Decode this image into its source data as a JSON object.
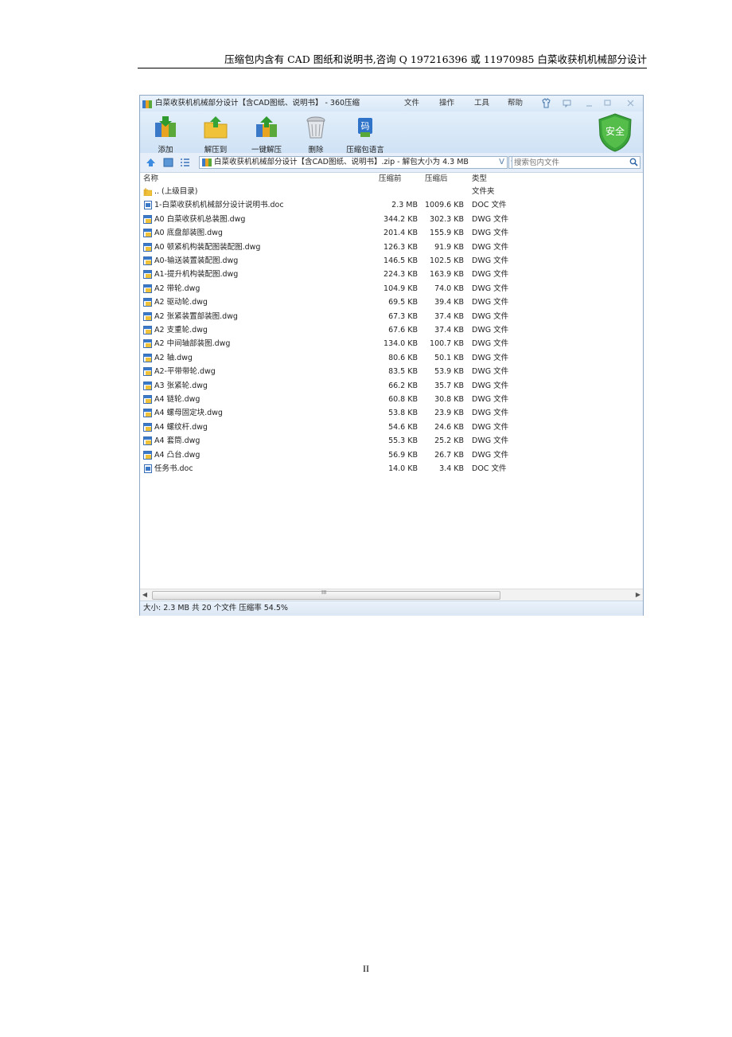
{
  "page": {
    "header": "压缩包内含有 CAD 图纸和说明书,咨询 Q 197216396 或 11970985 白菜收获机机械部分设计",
    "footer": "II"
  },
  "window": {
    "title": "白菜收获机机械部分设计【含CAD图纸、说明书】 - 360压缩",
    "menus": [
      "文件",
      "操作",
      "工具",
      "帮助"
    ],
    "toolbar": [
      "添加",
      "解压到",
      "一键解压",
      "删除",
      "压缩包语言"
    ],
    "safe_label": "安全",
    "path": "白菜收获机机械部分设计【含CAD图纸、说明书】.zip - 解包大小为 4.3 MB",
    "search_placeholder": "搜索包内文件",
    "columns": {
      "name": "名称",
      "before": "压缩前",
      "after": "压缩后",
      "type": "类型"
    },
    "rows": [
      {
        "name": ".. (上级目录)",
        "before": "",
        "after": "",
        "type": "文件夹",
        "icon": "folder-icon"
      },
      {
        "name": "1-白菜收获机机械部分设计说明书.doc",
        "before": "2.3 MB",
        "after": "1009.6 KB",
        "type": "DOC 文件",
        "icon": "doc-icon"
      },
      {
        "name": "A0 白菜收获机总装图.dwg",
        "before": "344.2 KB",
        "after": "302.3 KB",
        "type": "DWG 文件",
        "icon": "dwg-icon"
      },
      {
        "name": "A0 底盘部装图.dwg",
        "before": "201.4 KB",
        "after": "155.9 KB",
        "type": "DWG 文件",
        "icon": "dwg-icon"
      },
      {
        "name": "A0 顿紧机构装配图装配图.dwg",
        "before": "126.3 KB",
        "after": "91.9 KB",
        "type": "DWG 文件",
        "icon": "dwg-icon"
      },
      {
        "name": "A0-输送装置装配图.dwg",
        "before": "146.5 KB",
        "after": "102.5 KB",
        "type": "DWG 文件",
        "icon": "dwg-icon"
      },
      {
        "name": "A1-提升机构装配图.dwg",
        "before": "224.3 KB",
        "after": "163.9 KB",
        "type": "DWG 文件",
        "icon": "dwg-icon"
      },
      {
        "name": "A2 带轮.dwg",
        "before": "104.9 KB",
        "after": "74.0 KB",
        "type": "DWG 文件",
        "icon": "dwg-icon"
      },
      {
        "name": "A2 驱动轮.dwg",
        "before": "69.5 KB",
        "after": "39.4 KB",
        "type": "DWG 文件",
        "icon": "dwg-icon"
      },
      {
        "name": "A2 张紧装置部装图.dwg",
        "before": "67.3 KB",
        "after": "37.4 KB",
        "type": "DWG 文件",
        "icon": "dwg-icon"
      },
      {
        "name": "A2 支重轮.dwg",
        "before": "67.6 KB",
        "after": "37.4 KB",
        "type": "DWG 文件",
        "icon": "dwg-icon"
      },
      {
        "name": "A2 中间轴部装图.dwg",
        "before": "134.0 KB",
        "after": "100.7 KB",
        "type": "DWG 文件",
        "icon": "dwg-icon"
      },
      {
        "name": "A2 轴.dwg",
        "before": "80.6 KB",
        "after": "50.1 KB",
        "type": "DWG 文件",
        "icon": "dwg-icon"
      },
      {
        "name": "A2-平带带轮.dwg",
        "before": "83.5 KB",
        "after": "53.9 KB",
        "type": "DWG 文件",
        "icon": "dwg-icon"
      },
      {
        "name": "A3 张紧轮.dwg",
        "before": "66.2 KB",
        "after": "35.7 KB",
        "type": "DWG 文件",
        "icon": "dwg-icon"
      },
      {
        "name": "A4 链轮.dwg",
        "before": "60.8 KB",
        "after": "30.8 KB",
        "type": "DWG 文件",
        "icon": "dwg-icon"
      },
      {
        "name": "A4 螺母固定块.dwg",
        "before": "53.8 KB",
        "after": "23.9 KB",
        "type": "DWG 文件",
        "icon": "dwg-icon"
      },
      {
        "name": "A4 螺纹杆.dwg",
        "before": "54.6 KB",
        "after": "24.6 KB",
        "type": "DWG 文件",
        "icon": "dwg-icon"
      },
      {
        "name": "A4 套筒.dwg",
        "before": "55.3 KB",
        "after": "25.2 KB",
        "type": "DWG 文件",
        "icon": "dwg-icon"
      },
      {
        "name": "A4 凸台.dwg",
        "before": "56.9 KB",
        "after": "26.7 KB",
        "type": "DWG 文件",
        "icon": "dwg-icon"
      },
      {
        "name": "任务书.doc",
        "before": "14.0 KB",
        "after": "3.4 KB",
        "type": "DOC 文件",
        "icon": "doc-icon"
      }
    ],
    "status": "大小: 2.3 MB 共 20 个文件 压缩率 54.5%"
  },
  "colors": {
    "accent": "#3f7cc4",
    "safe_green": "#3aa33a",
    "title_bg": "#dfeefb"
  }
}
